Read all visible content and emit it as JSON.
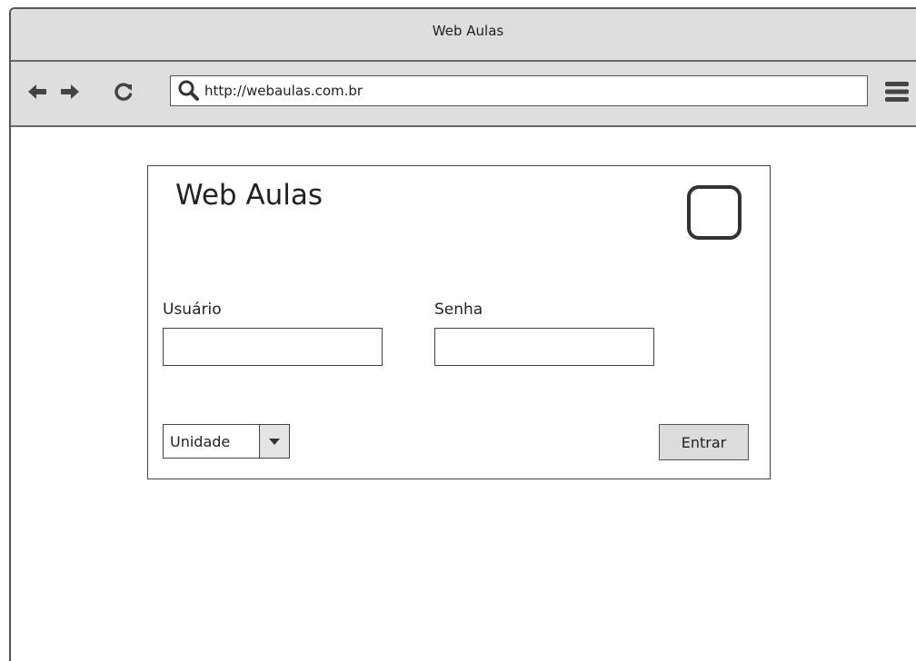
{
  "window": {
    "title": "Web Aulas"
  },
  "browser": {
    "url": "http://webaulas.com.br",
    "icons": {
      "back": "arrow-left-icon",
      "forward": "arrow-right-icon",
      "reload": "reload-icon",
      "search": "search-icon",
      "menu": "hamburger-menu-icon"
    }
  },
  "login": {
    "title": "Web Aulas",
    "logo_icon": "logo-placeholder-icon",
    "username_label": "Usuário",
    "username_value": "",
    "password_label": "Senha",
    "password_value": "",
    "unit_select_value": "Unidade",
    "submit_label": "Entrar"
  },
  "colors": {
    "chrome": "#dedede",
    "border": "#444444",
    "button": "#dcdcdc"
  }
}
